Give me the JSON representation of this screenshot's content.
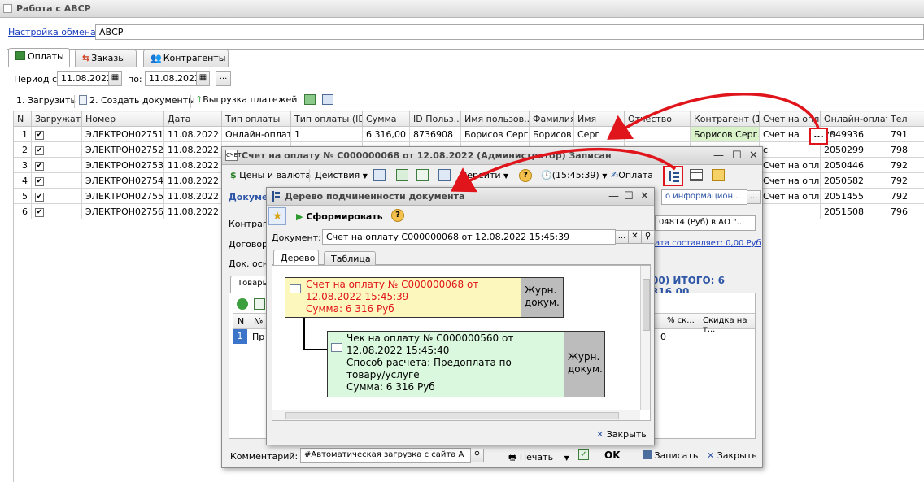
{
  "window": {
    "title": "Работа с АВСР"
  },
  "exchange": {
    "link": "Настройка обмена",
    "value": "АВСР"
  },
  "tabs": [
    {
      "label": "Оплаты"
    },
    {
      "label": "Заказы"
    },
    {
      "label": "Контрагенты"
    }
  ],
  "period": {
    "from_label": "Период с:",
    "from": "11.08.2022",
    "to_label": "по:",
    "to": "11.08.2022",
    "more": "..."
  },
  "toolbar": {
    "load": "1. Загрузить",
    "create": "2. Создать документы",
    "export": "Выгрузка платежей"
  },
  "table": {
    "headers": [
      "N",
      "Загружать",
      "Номер",
      "Дата",
      "Тип оплаты",
      "Тип оплаты (ID)",
      "Сумма",
      "ID Польз...",
      "Имя пользов...",
      "Фамилия",
      "Имя",
      "Отчество",
      "Контрагент (1...",
      "Счет на опла...",
      "Онлайн-оплат...",
      "Тел"
    ],
    "rows": [
      {
        "n": "1",
        "num": "ЭЛЕКТРОН02751",
        "date": "11.08.2022",
        "type": "Онлайн-оплата",
        "type_id": "1",
        "sum": "6 316,00",
        "uid": "8736908",
        "uname": "Борисов Серг...",
        "last": "Борисов",
        "first": "Серг",
        "kontr": "Борисов Серг...",
        "schet": "Счет на",
        "online": "2049936",
        "tel": "791"
      },
      {
        "n": "2",
        "num": "ЭЛЕКТРОН02752",
        "date": "11.08.2022",
        "schet": "с",
        "online": "2050299",
        "tel": "798"
      },
      {
        "n": "3",
        "num": "ЭЛЕКТРОН02753",
        "date": "11.08.2022",
        "schet": "Счет на опл...",
        "online": "2050446",
        "tel": "792"
      },
      {
        "n": "4",
        "num": "ЭЛЕКТРОН02754",
        "date": "11.08.2022",
        "schet": "Счет на опл...",
        "online": "2050582",
        "tel": "792"
      },
      {
        "n": "5",
        "num": "ЭЛЕКТРОН02755",
        "date": "11.08.2022",
        "schet": "Счет на опл...",
        "online": "2051455",
        "tel": "792"
      },
      {
        "n": "6",
        "num": "ЭЛЕКТРОН02756",
        "date": "11.08.2022",
        "online": "2051508",
        "tel": "796"
      }
    ]
  },
  "invoice": {
    "title": "Счет на оплату № С000000068 от 12.08.2022 (Администратор) Записан",
    "toolbar": {
      "prices": "Цены и валюта",
      "actions": "Действия",
      "goto": "Перейти",
      "time": "(15:45:39)",
      "pay": "Оплата"
    },
    "doc_label": "Докуме",
    "info_link": "о информацион...",
    "kontr_label": "Контраге",
    "dogovor_label": "Договор:",
    "dogovor_value": "04814 (Руб) в АО \"...",
    "payment_link": "ата составляет: 0,00 Руб",
    "dok_osn_label": "Док. осно",
    "total": "00) ИТОГО: 6 316,00",
    "inner_tab": "Товары",
    "grid_n": "N",
    "grid_no": "№",
    "grid_row": "1",
    "grid_row_text": "Пр",
    "grid_discount_pct": "% ск...",
    "grid_discount": "Скидка на т...",
    "grid_val": "0",
    "comment_label": "Комментарий:",
    "comment": "#Автоматическая загрузка с сайта А",
    "print": "Печать",
    "ok": "OK",
    "save": "Записать",
    "close": "Закрыть"
  },
  "tree": {
    "title": "Дерево подчиненности документа",
    "form": "Сформировать",
    "doc_label": "Документ:",
    "doc_value": "Счет на оплату С000000068 от 12.08.2022 15:45:39",
    "tab_tree": "Дерево",
    "tab_table": "Таблица",
    "node1": {
      "l1": "Счет на оплату № С000000068 от",
      "l2": "12.08.2022 15:45:39",
      "l3": "Сумма: 6 316 Руб",
      "j1": "Журн.",
      "j2": "докум."
    },
    "node2": {
      "l1": "Чек на оплату № С000000560 от",
      "l2": "12.08.2022 15:45:40",
      "l3": "Способ расчета: Предоплата по",
      "l4": "товару/услуге",
      "l5": "Сумма: 6 316 Руб",
      "j1": "Журн.",
      "j2": "докум."
    },
    "close": "Закрыть"
  },
  "colors": {
    "accent_red": "#e0141b",
    "node1_bg": "#fcf7bd",
    "node2_bg": "#d9f8dd",
    "kontr_bg": "#d9f2c9",
    "link": "#1b3fbf",
    "selected_row": "#3b74c9"
  }
}
